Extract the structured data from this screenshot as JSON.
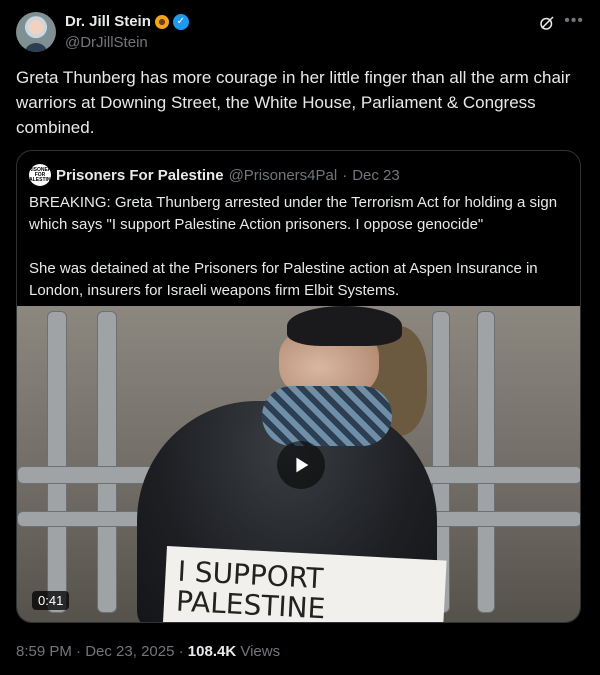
{
  "author": {
    "name": "Dr. Jill Stein",
    "handle": "@DrJillStein"
  },
  "tweet": {
    "text": "Greta Thunberg has more courage in her little finger than all the arm chair warriors at Downing Street, the White House, Parliament & Congress combined."
  },
  "quoted": {
    "avatar_text": "PRISONERS FOR PALESTINE",
    "name": "Prisoners For Palestine",
    "handle": "@Prisoners4Pal",
    "separator": "·",
    "date": "Dec 23",
    "text": "BREAKING: Greta Thunberg arrested under the Terrorism Act for holding a sign which says \"I support Palestine Action prisoners. I oppose genocide\"\n\nShe was detained at the Prisoners for Palestine action at Aspen Insurance in London, insurers for Israeli weapons firm Elbit Systems.",
    "video": {
      "duration": "0:41",
      "sign_text": "I SUPPORT\nPALESTINE"
    }
  },
  "meta": {
    "time": "8:59 PM",
    "separator": "·",
    "date": "Dec 23, 2025",
    "separator2": "·",
    "views_count": "108.4K",
    "views_label": "Views"
  },
  "icons": [
    "sunflower-icon",
    "verified-badge-icon",
    "grok-icon",
    "more-icon",
    "play-icon"
  ],
  "colors": {
    "background": "#000000",
    "text": "#e7e9ea",
    "secondary": "#71767b",
    "accent": "#1d9bf0",
    "border": "#2f3336"
  }
}
